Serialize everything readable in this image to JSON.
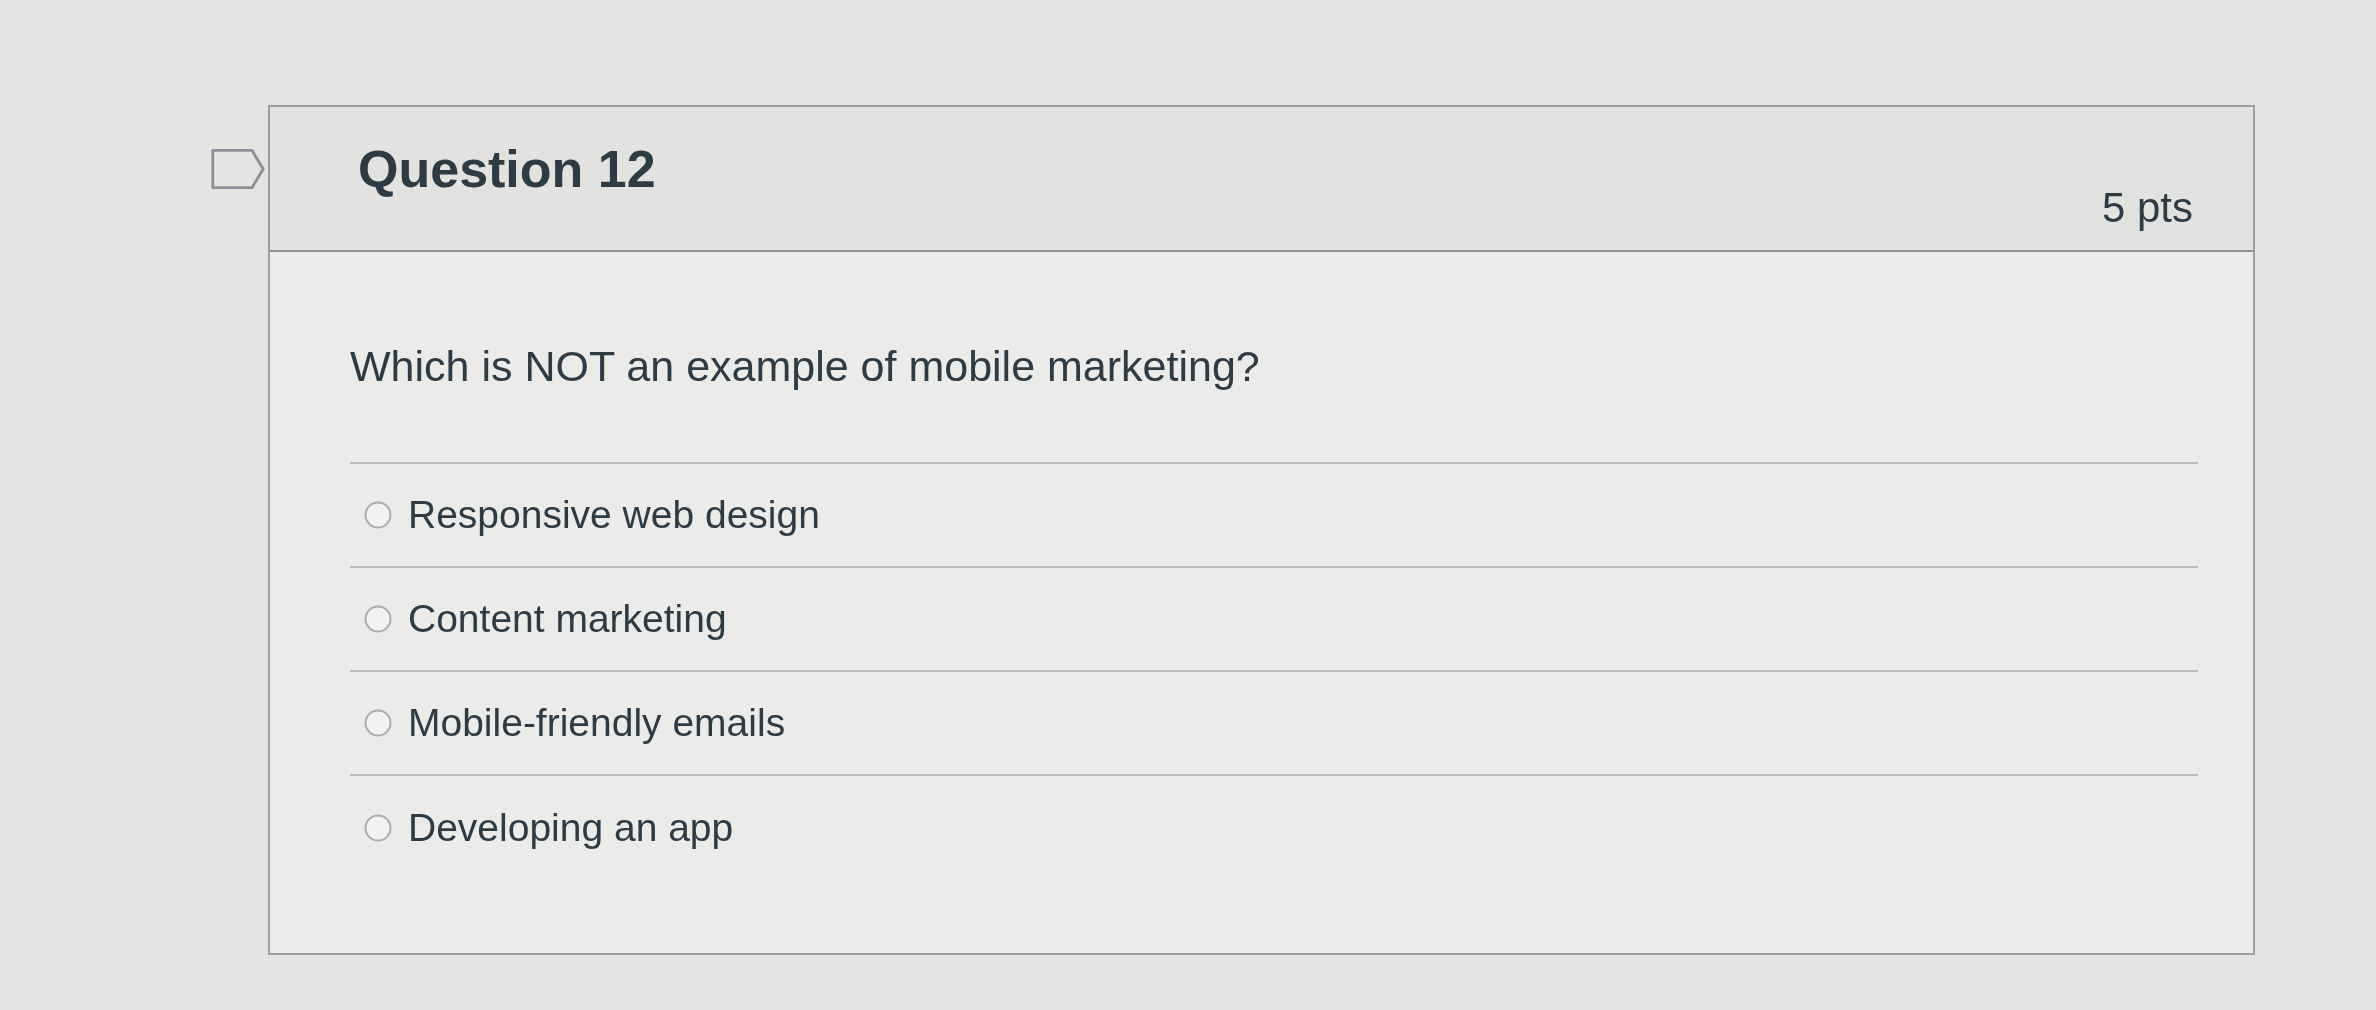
{
  "flag": {
    "flagged": false
  },
  "question": {
    "title": "Question 12",
    "points": "5 pts",
    "text": "Which is NOT an example of mobile marketing?"
  },
  "answers": [
    {
      "label": "Responsive web design",
      "selected": false
    },
    {
      "label": "Content marketing",
      "selected": false
    },
    {
      "label": "Mobile-friendly emails",
      "selected": false
    },
    {
      "label": "Developing an app",
      "selected": false
    }
  ]
}
